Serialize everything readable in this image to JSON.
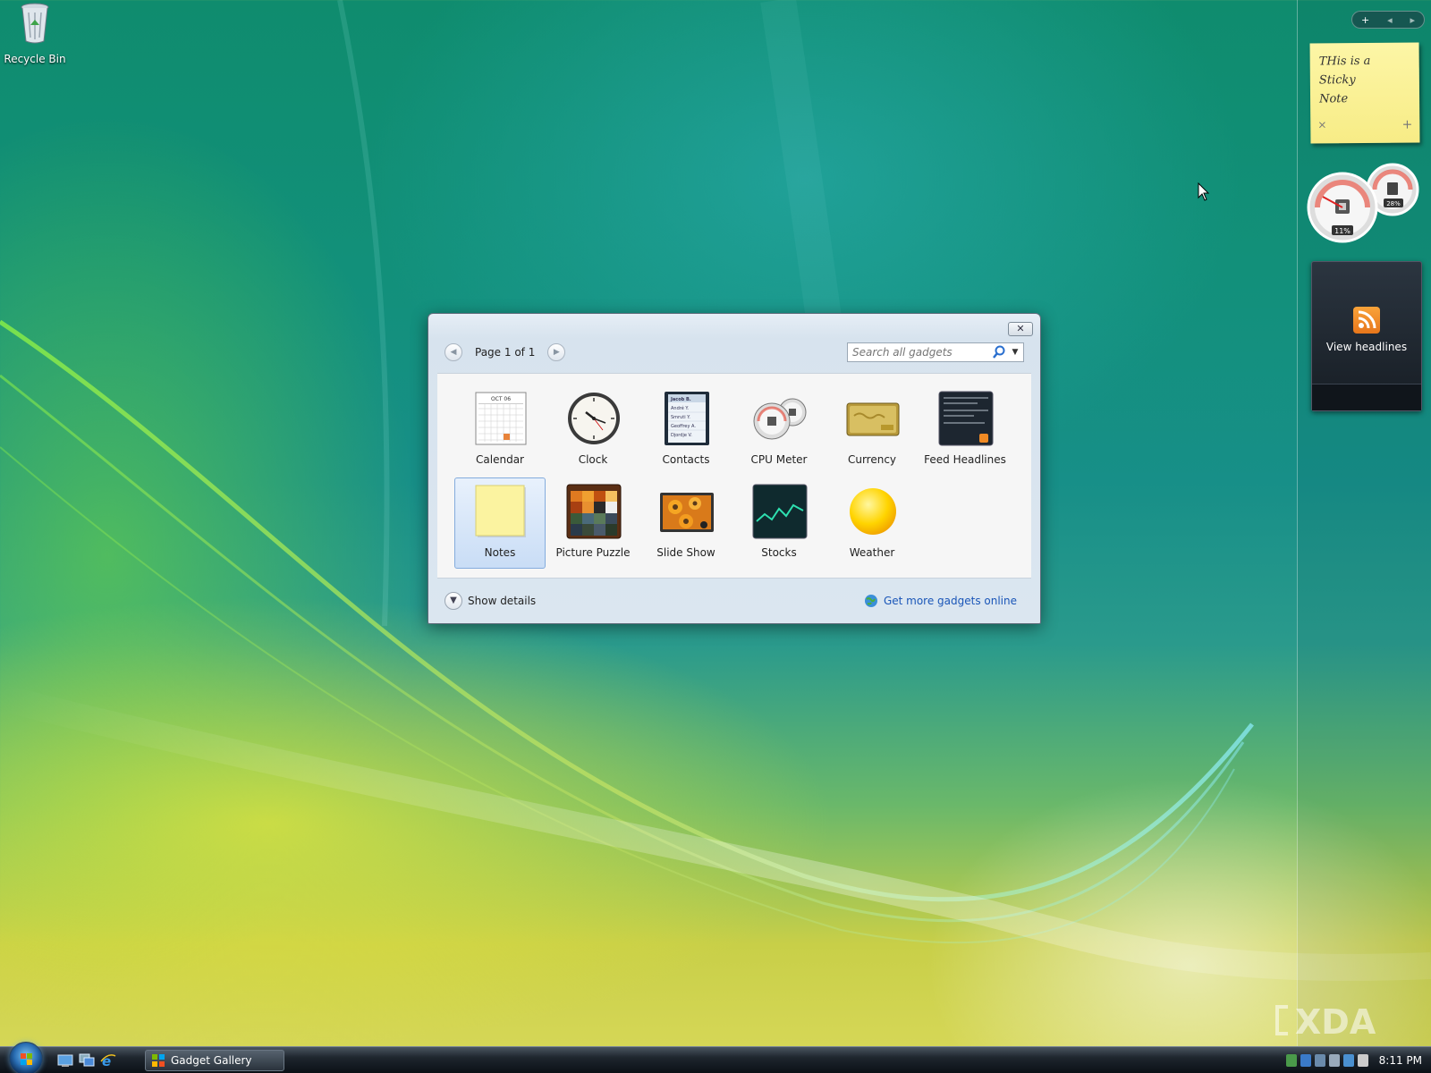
{
  "desktop": {
    "recycle_bin_label": "Recycle Bin"
  },
  "sidebar": {
    "controls": {
      "add_icon": "+",
      "prev_icon": "◂",
      "next_icon": "▸"
    },
    "sticky_note": {
      "text_line1": "THis is a Sticky",
      "text_line2": "Note",
      "delete_icon": "×",
      "add_icon": "+"
    },
    "cpu_meter": {
      "cpu_percent_label": "11%",
      "memory_percent_label": "28%",
      "cpu_value": 0.11,
      "memory_value": 0.28
    },
    "feed_headlines": {
      "button_label": "View headlines"
    }
  },
  "gallery": {
    "close_icon": "close-icon",
    "pager": {
      "label": "Page 1 of 1"
    },
    "search": {
      "placeholder": "Search all gadgets"
    },
    "items": [
      {
        "label": "Calendar",
        "icon": "calendar-icon",
        "calendar_month": "OCT 06"
      },
      {
        "label": "Clock",
        "icon": "clock-icon"
      },
      {
        "label": "Contacts",
        "icon": "contacts-icon",
        "contacts": [
          "Jacob B.",
          "André Y.",
          "Smruti Y.",
          "Geoffrey A.",
          "Djordje V."
        ]
      },
      {
        "label": "CPU Meter",
        "icon": "cpu-meter-icon"
      },
      {
        "label": "Currency",
        "icon": "currency-icon"
      },
      {
        "label": "Feed Headlines",
        "icon": "feed-headlines-icon"
      },
      {
        "label": "Notes",
        "icon": "notes-icon",
        "selected": true
      },
      {
        "label": "Picture Puzzle",
        "icon": "picture-puzzle-icon"
      },
      {
        "label": "Slide Show",
        "icon": "slide-show-icon"
      },
      {
        "label": "Stocks",
        "icon": "stocks-icon"
      },
      {
        "label": "Weather",
        "icon": "weather-icon"
      }
    ],
    "footer": {
      "show_details_label": "Show details",
      "get_more_label": "Get more gadgets online"
    }
  },
  "watermark": {
    "text": "XDA"
  },
  "taskbar": {
    "window_button_label": "Gadget Gallery",
    "clock": "8:11 PM"
  },
  "colors": {
    "link": "#1a56b8",
    "selection_border": "#84acdd",
    "sticky_note": "#fdf6a6",
    "rss_orange": "#f08a24"
  }
}
